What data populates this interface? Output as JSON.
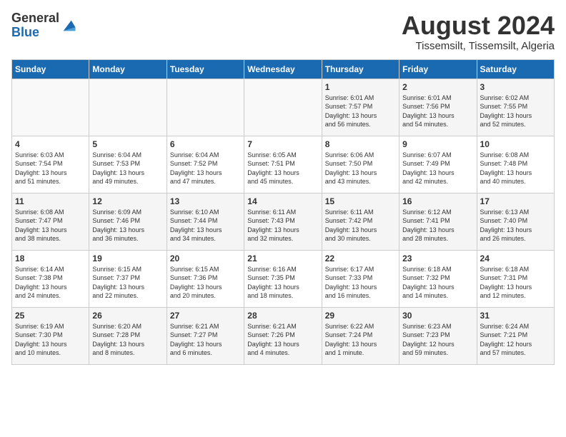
{
  "header": {
    "logo_general": "General",
    "logo_blue": "Blue",
    "month_title": "August 2024",
    "location": "Tissemsilt, Tissemsilt, Algeria"
  },
  "weekdays": [
    "Sunday",
    "Monday",
    "Tuesday",
    "Wednesday",
    "Thursday",
    "Friday",
    "Saturday"
  ],
  "weeks": [
    [
      {
        "day": "",
        "info": ""
      },
      {
        "day": "",
        "info": ""
      },
      {
        "day": "",
        "info": ""
      },
      {
        "day": "",
        "info": ""
      },
      {
        "day": "1",
        "info": "Sunrise: 6:01 AM\nSunset: 7:57 PM\nDaylight: 13 hours\nand 56 minutes."
      },
      {
        "day": "2",
        "info": "Sunrise: 6:01 AM\nSunset: 7:56 PM\nDaylight: 13 hours\nand 54 minutes."
      },
      {
        "day": "3",
        "info": "Sunrise: 6:02 AM\nSunset: 7:55 PM\nDaylight: 13 hours\nand 52 minutes."
      }
    ],
    [
      {
        "day": "4",
        "info": "Sunrise: 6:03 AM\nSunset: 7:54 PM\nDaylight: 13 hours\nand 51 minutes."
      },
      {
        "day": "5",
        "info": "Sunrise: 6:04 AM\nSunset: 7:53 PM\nDaylight: 13 hours\nand 49 minutes."
      },
      {
        "day": "6",
        "info": "Sunrise: 6:04 AM\nSunset: 7:52 PM\nDaylight: 13 hours\nand 47 minutes."
      },
      {
        "day": "7",
        "info": "Sunrise: 6:05 AM\nSunset: 7:51 PM\nDaylight: 13 hours\nand 45 minutes."
      },
      {
        "day": "8",
        "info": "Sunrise: 6:06 AM\nSunset: 7:50 PM\nDaylight: 13 hours\nand 43 minutes."
      },
      {
        "day": "9",
        "info": "Sunrise: 6:07 AM\nSunset: 7:49 PM\nDaylight: 13 hours\nand 42 minutes."
      },
      {
        "day": "10",
        "info": "Sunrise: 6:08 AM\nSunset: 7:48 PM\nDaylight: 13 hours\nand 40 minutes."
      }
    ],
    [
      {
        "day": "11",
        "info": "Sunrise: 6:08 AM\nSunset: 7:47 PM\nDaylight: 13 hours\nand 38 minutes."
      },
      {
        "day": "12",
        "info": "Sunrise: 6:09 AM\nSunset: 7:46 PM\nDaylight: 13 hours\nand 36 minutes."
      },
      {
        "day": "13",
        "info": "Sunrise: 6:10 AM\nSunset: 7:44 PM\nDaylight: 13 hours\nand 34 minutes."
      },
      {
        "day": "14",
        "info": "Sunrise: 6:11 AM\nSunset: 7:43 PM\nDaylight: 13 hours\nand 32 minutes."
      },
      {
        "day": "15",
        "info": "Sunrise: 6:11 AM\nSunset: 7:42 PM\nDaylight: 13 hours\nand 30 minutes."
      },
      {
        "day": "16",
        "info": "Sunrise: 6:12 AM\nSunset: 7:41 PM\nDaylight: 13 hours\nand 28 minutes."
      },
      {
        "day": "17",
        "info": "Sunrise: 6:13 AM\nSunset: 7:40 PM\nDaylight: 13 hours\nand 26 minutes."
      }
    ],
    [
      {
        "day": "18",
        "info": "Sunrise: 6:14 AM\nSunset: 7:38 PM\nDaylight: 13 hours\nand 24 minutes."
      },
      {
        "day": "19",
        "info": "Sunrise: 6:15 AM\nSunset: 7:37 PM\nDaylight: 13 hours\nand 22 minutes."
      },
      {
        "day": "20",
        "info": "Sunrise: 6:15 AM\nSunset: 7:36 PM\nDaylight: 13 hours\nand 20 minutes."
      },
      {
        "day": "21",
        "info": "Sunrise: 6:16 AM\nSunset: 7:35 PM\nDaylight: 13 hours\nand 18 minutes."
      },
      {
        "day": "22",
        "info": "Sunrise: 6:17 AM\nSunset: 7:33 PM\nDaylight: 13 hours\nand 16 minutes."
      },
      {
        "day": "23",
        "info": "Sunrise: 6:18 AM\nSunset: 7:32 PM\nDaylight: 13 hours\nand 14 minutes."
      },
      {
        "day": "24",
        "info": "Sunrise: 6:18 AM\nSunset: 7:31 PM\nDaylight: 13 hours\nand 12 minutes."
      }
    ],
    [
      {
        "day": "25",
        "info": "Sunrise: 6:19 AM\nSunset: 7:30 PM\nDaylight: 13 hours\nand 10 minutes."
      },
      {
        "day": "26",
        "info": "Sunrise: 6:20 AM\nSunset: 7:28 PM\nDaylight: 13 hours\nand 8 minutes."
      },
      {
        "day": "27",
        "info": "Sunrise: 6:21 AM\nSunset: 7:27 PM\nDaylight: 13 hours\nand 6 minutes."
      },
      {
        "day": "28",
        "info": "Sunrise: 6:21 AM\nSunset: 7:26 PM\nDaylight: 13 hours\nand 4 minutes."
      },
      {
        "day": "29",
        "info": "Sunrise: 6:22 AM\nSunset: 7:24 PM\nDaylight: 13 hours\nand 1 minute."
      },
      {
        "day": "30",
        "info": "Sunrise: 6:23 AM\nSunset: 7:23 PM\nDaylight: 12 hours\nand 59 minutes."
      },
      {
        "day": "31",
        "info": "Sunrise: 6:24 AM\nSunset: 7:21 PM\nDaylight: 12 hours\nand 57 minutes."
      }
    ]
  ]
}
